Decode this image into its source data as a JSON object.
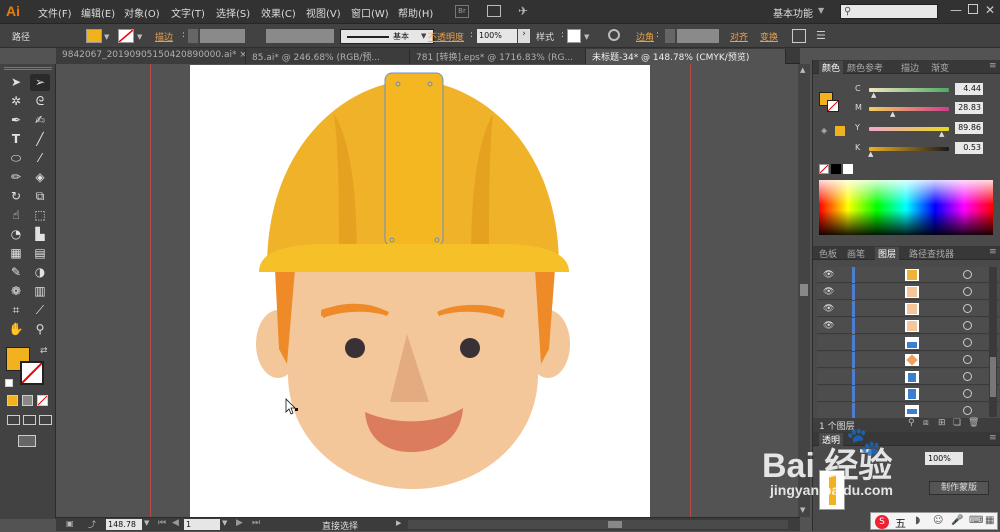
{
  "app": {
    "logo": "Ai",
    "workspace": "基本功能",
    "search_placeholder": ""
  },
  "menu": [
    "文件(F)",
    "编辑(E)",
    "对象(O)",
    "文字(T)",
    "选择(S)",
    "效果(C)",
    "视图(V)",
    "窗口(W)",
    "帮助(H)"
  ],
  "bridge_label": "Br",
  "control": {
    "selection_type": "路径",
    "stroke_label": "描边",
    "brush_label": "基本",
    "opacity_label": "不透明度",
    "opacity_value": "100%",
    "style_label": "样式",
    "corner_label": "边角",
    "align_label": "对齐",
    "transform_label": "变换",
    "fill_color": "#f2b11f"
  },
  "tabs": [
    {
      "label": "9842067_20190905150420890000.ai* ×",
      "active": false
    },
    {
      "label": "85.ai* @ 246.68% (RGB/预...",
      "active": false
    },
    {
      "label": "781 [转换].eps* @ 1716.83% (RG...",
      "active": false
    },
    {
      "label": "未标题-34* @ 148.78% (CMYK/预览)",
      "active": true
    }
  ],
  "tools": [
    "selection-tool",
    "direct-selection-tool",
    "magic-wand-tool",
    "lasso-tool",
    "pen-tool",
    "curvature-tool",
    "type-tool",
    "line-tool",
    "ellipse-tool",
    "paintbrush-tool",
    "pencil-tool",
    "eraser-tool",
    "rotate-tool",
    "scale-tool",
    "warp-tool",
    "free-transform-tool",
    "shape-builder-tool",
    "chart-tool",
    "mesh-tool",
    "gradient-tool",
    "eyedropper-tool",
    "blend-tool",
    "symbol-sprayer-tool",
    "column-graph-tool",
    "artboard-tool",
    "slice-tool",
    "hand-tool",
    "zoom-tool"
  ],
  "color_panel": {
    "tabs": [
      "颜色",
      "颜色参考",
      "描边",
      "渐变"
    ],
    "channels": [
      {
        "label": "C",
        "value": "4.44",
        "color": "#4fa868"
      },
      {
        "label": "M",
        "value": "28.83",
        "color": "#d13c8c"
      },
      {
        "label": "Y",
        "value": "89.86",
        "color": "#e8d81a"
      },
      {
        "label": "K",
        "value": "0.53",
        "color": "#333333"
      }
    ],
    "swatch": "#f2b11f"
  },
  "layers_panel": {
    "tabs": [
      "色板",
      "画笔",
      "图层",
      "路径查找器"
    ],
    "footer": "1 个图层",
    "rows": [
      {
        "visible": true,
        "thumb": "#f0b33a"
      },
      {
        "visible": true,
        "thumb": "#f3c79a"
      },
      {
        "visible": true,
        "thumb": "#f3c79a"
      },
      {
        "visible": true,
        "thumb": "#f3c79a"
      },
      {
        "visible": false,
        "thumb": "#3a7fd0"
      },
      {
        "visible": false,
        "thumb": "#f1a25a"
      },
      {
        "visible": false,
        "thumb": "#3a7fd0"
      },
      {
        "visible": false,
        "thumb": "#3a7fd0"
      },
      {
        "visible": false,
        "thumb": "#3a7fd0"
      }
    ]
  },
  "transparency": {
    "label": "透明",
    "value": "100%",
    "make_mask": "制作蒙版"
  },
  "status": {
    "zoom": "148.78",
    "artboard": "1",
    "tool_name": "直接选择"
  },
  "watermark": {
    "brand": "Bai 经验",
    "site": "jingyan.baidu.com"
  },
  "ime": {
    "label": "五"
  }
}
